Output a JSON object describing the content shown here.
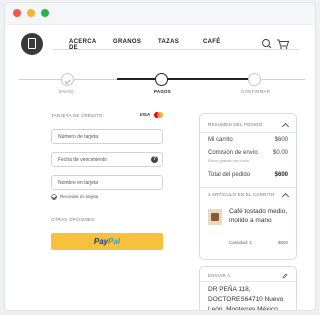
{
  "nav": {
    "links": [
      "ACERCA DE",
      "GRANOS",
      "TAZAS",
      "CAFÉ"
    ]
  },
  "stepper": {
    "steps": [
      "ENVÍO",
      "PAGOS",
      "CONFIRMAR"
    ],
    "active_index": 1
  },
  "payment": {
    "card_title": "TARJETA DE CRÉDITO:",
    "card_brands": [
      "VISA",
      "mastercard"
    ],
    "card_number_placeholder": "Número de tarjeta",
    "expiry_placeholder": "Fecha de vencimiento",
    "name_placeholder": "Nombre en tarjeta",
    "help_icon": "?",
    "remember_label": "Recordar mi tarjeta",
    "other_options_title": "OTRAS OPCIONES:",
    "paypal_pay": "Pay",
    "paypal_pal": "Pal"
  },
  "summary": {
    "title": "RESUMEN DEL PEDIDO:",
    "cart_label": "Mi carrito",
    "cart_value": "$600",
    "shipping_label": "Comisión de envío",
    "shipping_value": "$0.00",
    "shipping_note": "Envío gratuito en costo",
    "total_label": "Total del pedido",
    "total_value": "$600",
    "items_title": "1 ARTÍCULO EN EL CARRITO",
    "product_name": "Café tostado medio, molido a mano",
    "qty_label": "Cantidad: 1",
    "item_price": "$600"
  },
  "shipping": {
    "title": "ENVIAR A:",
    "address": "DR PEÑA 118, DOCTORES64710 Nuevo León, Monterrey México"
  },
  "colors": {
    "accent": "#222222",
    "paypal_yellow": "#f6c23e",
    "paypal_dark_blue": "#1b3a8a",
    "paypal_light_blue": "#2aa0dd"
  }
}
